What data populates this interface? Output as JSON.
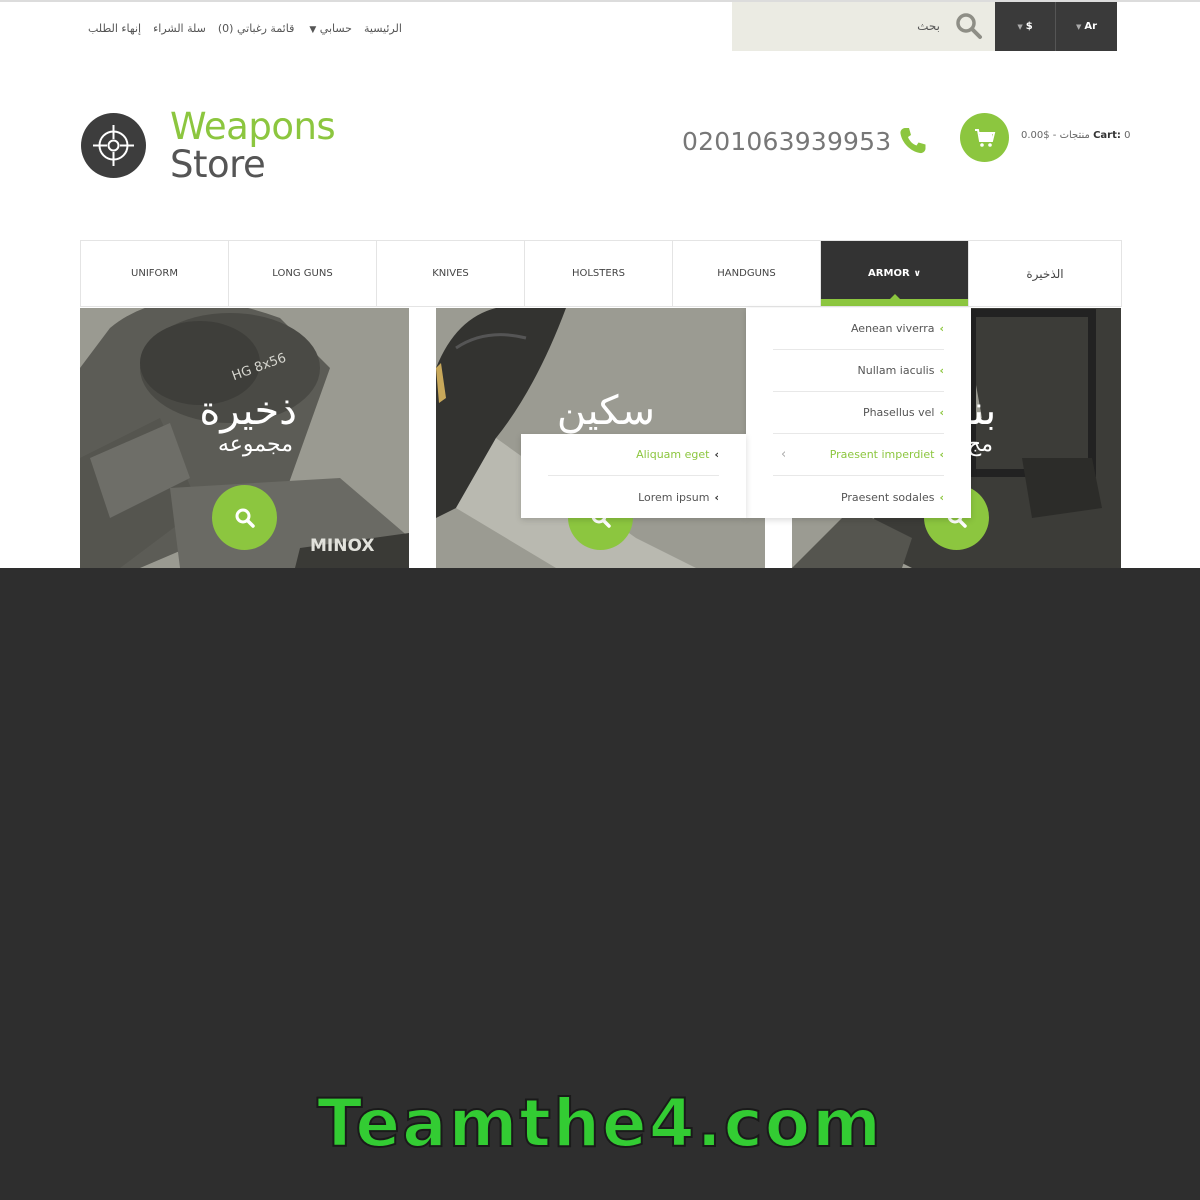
{
  "top_links": {
    "home": "الرئيسية",
    "account": "حسابي",
    "wishlist": "قائمة رغباتي (0)",
    "cart": "سلة الشراء",
    "checkout": "إنهاء الطلب"
  },
  "search": {
    "placeholder": "بحث"
  },
  "currency": {
    "selected": "$"
  },
  "language": {
    "selected": "Ar"
  },
  "logo": {
    "line1": "Weapons",
    "line2": "Store"
  },
  "phone": {
    "number": "0201063939953"
  },
  "cart": {
    "label": "Cart:",
    "count": "0",
    "summary": "منتجات - $0.00"
  },
  "nav": {
    "items": [
      {
        "label": "UNIFORM"
      },
      {
        "label": "LONG GUNS"
      },
      {
        "label": "KNIVES"
      },
      {
        "label": "HOLSTERS"
      },
      {
        "label": "HANDGUNS"
      },
      {
        "label": "ARMOR"
      },
      {
        "label": "الذخيرة"
      }
    ],
    "active_index": 5
  },
  "banners": [
    {
      "title": "ذخيرة",
      "subtitle": "مجموعه",
      "image_text": "HG 8x56",
      "image_text2": "MINOX"
    },
    {
      "title": "سكين",
      "subtitle": ""
    },
    {
      "title": "بند",
      "subtitle": "مج"
    }
  ],
  "dropdown": {
    "items": [
      "Aenean viverra",
      "Nullam iaculis",
      "Phasellus vel",
      "Praesent imperdiet",
      "Praesent sodales"
    ],
    "highlighted_index": 3,
    "submenu": [
      "Aliquam eget",
      "Lorem ipsum"
    ],
    "submenu_highlighted_index": 0
  },
  "colors": {
    "accent": "#8cc63f",
    "dark": "#333333",
    "overlay": "#2e2e2e",
    "watermark": "#33cc33"
  },
  "watermark": {
    "text": "Teamthe4.com"
  }
}
